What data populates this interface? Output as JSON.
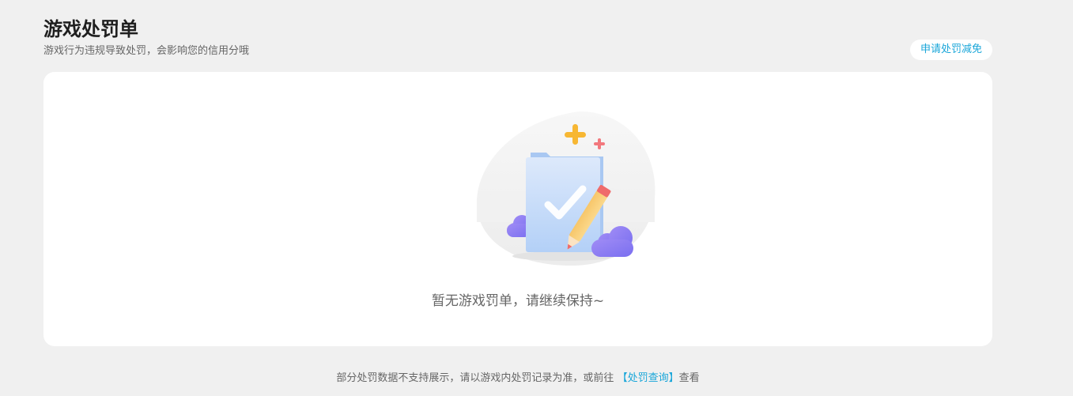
{
  "header": {
    "title": "游戏处罚单",
    "subtitle": "游戏行为违规导致处罚，会影响您的信用分哦",
    "apply_reduction_label": "申请处罚减免"
  },
  "empty_state": {
    "message": "暂无游戏罚单，请继续保持~",
    "illustration_icon": "folder-check-pencil-icon"
  },
  "footer": {
    "note_before": "部分处罚数据不支持展示，请以游戏内处罚记录为准，或前往",
    "link_label": "【处罚查询】",
    "note_after": "查看"
  },
  "colors": {
    "background": "#f0f0f0",
    "card": "#ffffff",
    "accent": "#19a6d9",
    "title": "#1f1f1f",
    "muted_text": "#666666"
  }
}
